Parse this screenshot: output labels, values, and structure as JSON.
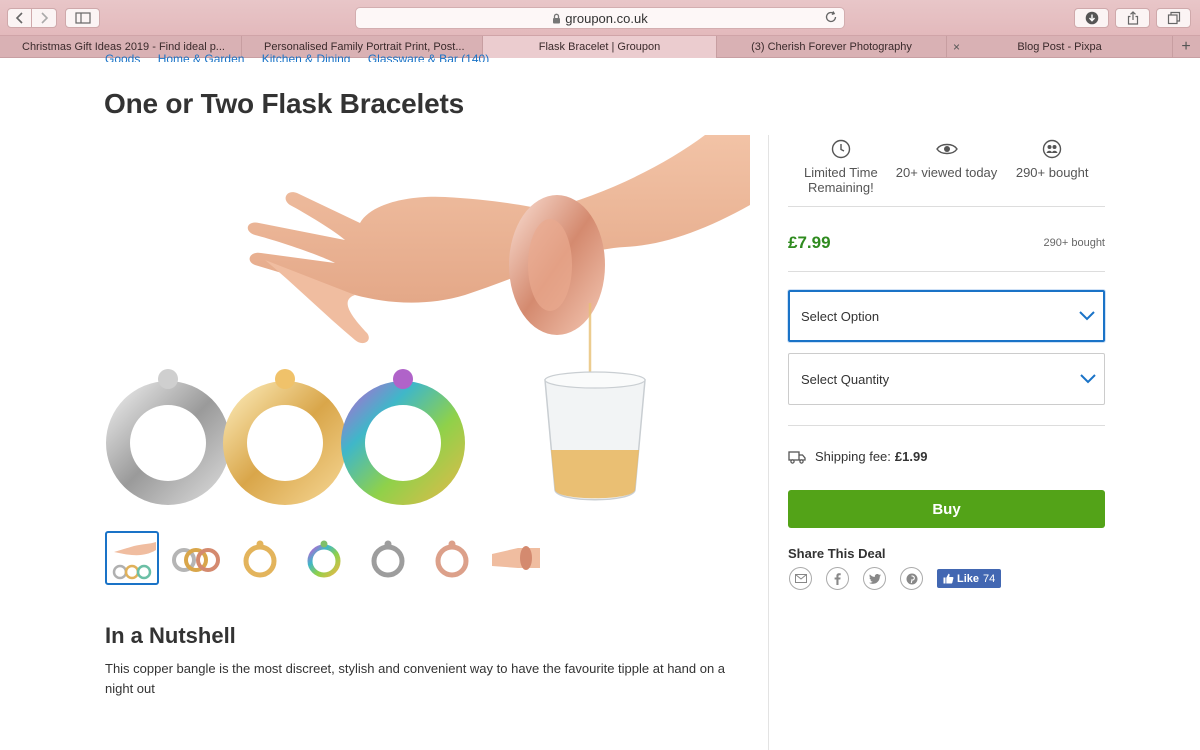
{
  "browser": {
    "url": "groupon.co.uk",
    "tabs": [
      {
        "label": "Christmas Gift Ideas 2019 - Find ideal p...",
        "active": false
      },
      {
        "label": "Personalised Family Portrait Print, Post...",
        "active": false
      },
      {
        "label": "Flask Bracelet | Groupon",
        "active": true
      },
      {
        "label": "(3) Cherish Forever Photography",
        "active": false
      },
      {
        "label": "Blog Post - Pixpa",
        "active": false
      }
    ],
    "close_glyph": "×",
    "new_tab_glyph": "+"
  },
  "breadcrumb": [
    "Goods",
    "Home & Garden",
    "Kitchen & Dining",
    "Glassware & Bar (140)"
  ],
  "deal": {
    "title": "One or Two Flask Bracelets",
    "thumbnail_count": 7,
    "selected_thumbnail": 0
  },
  "stats": [
    {
      "icon": "clock-icon",
      "label": "Limited Time Remaining!"
    },
    {
      "icon": "eye-icon",
      "label": "20+ viewed today"
    },
    {
      "icon": "people-icon",
      "label": "290+ bought"
    }
  ],
  "price": {
    "value": "£7.99",
    "bought": "290+ bought"
  },
  "selects": {
    "option": "Select Option",
    "quantity": "Select Quantity"
  },
  "shipping": {
    "label": "Shipping fee:",
    "value": "£1.99"
  },
  "buy_label": "Buy",
  "share": {
    "heading": "Share This Deal",
    "icons": [
      "email-icon",
      "facebook-icon",
      "twitter-icon",
      "pinterest-icon"
    ],
    "like_label": "Like",
    "like_count": "74"
  },
  "nutshell": {
    "heading": "In a Nutshell",
    "text": "This copper bangle is the most discreet, stylish and convenient way to have the favourite tipple at hand on a night out"
  },
  "colors": {
    "accent": "#1a73c7",
    "price": "#2f8b1f",
    "buy": "#53a318",
    "facebook": "#4267b2"
  }
}
